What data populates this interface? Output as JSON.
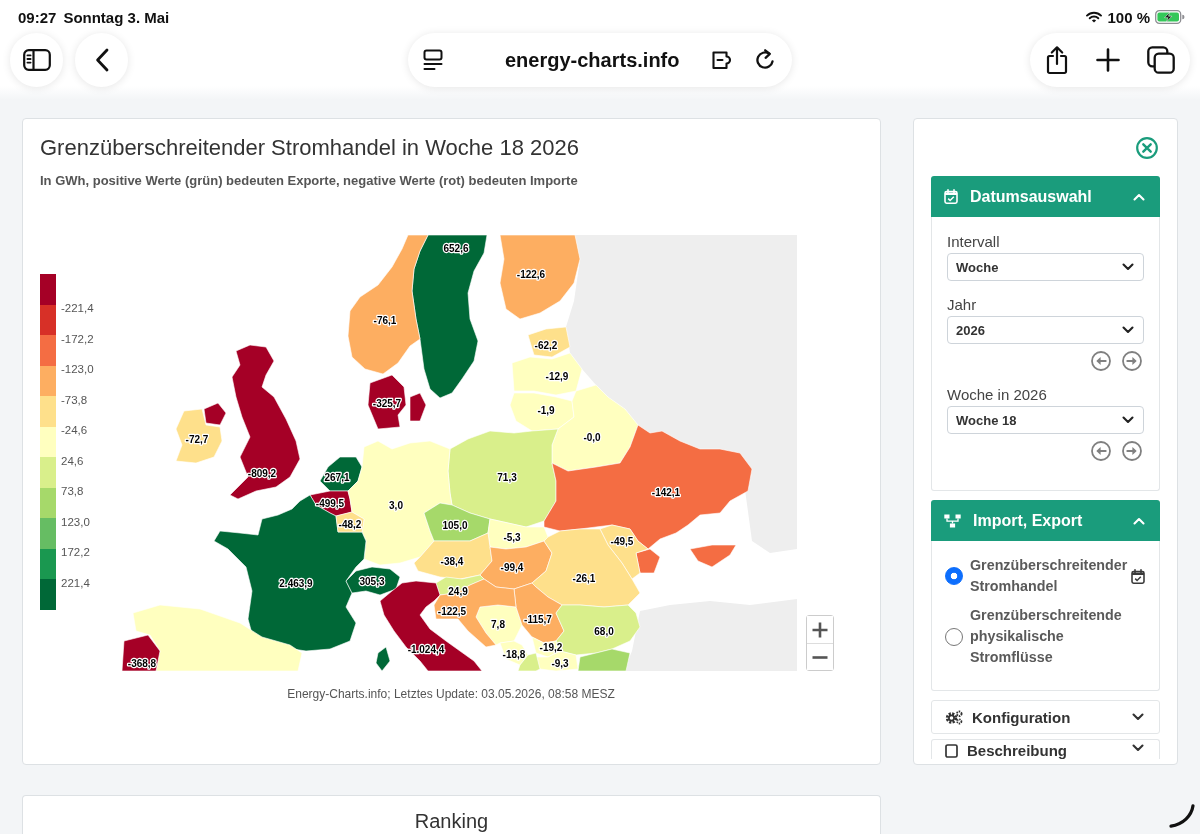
{
  "status_bar": {
    "time": "09:27",
    "date": "Sonntag 3. Mai",
    "battery": "100 %"
  },
  "browser": {
    "url": "energy-charts.info"
  },
  "chart": {
    "title": "Grenzüberschreitender Stromhandel in Woche 18 2026",
    "subtitle": "In GWh, positive Werte (grün) bedeuten Exporte, negative Werte (rot) bedeuten Importe",
    "map": {
      "legend": {
        "bins": [
          {
            "color": "#a50026"
          },
          {
            "color": "#d73027"
          },
          {
            "color": "#f46d43"
          },
          {
            "color": "#fdae61"
          },
          {
            "color": "#fee08b"
          },
          {
            "color": "#ffffbf"
          },
          {
            "color": "#d9ef8b"
          },
          {
            "color": "#a6d96a"
          },
          {
            "color": "#66bd63"
          },
          {
            "color": "#1a9850"
          },
          {
            "color": "#006837"
          }
        ],
        "ticks": [
          "-221,4",
          "-172,2",
          "-123,0",
          "-73,8",
          "-24,6",
          "24,6",
          "73,8",
          "123,0",
          "172,2",
          "221,4"
        ]
      },
      "regions": [
        {
          "value": "652,6",
          "color": "#006837"
        },
        {
          "value": "-122,6",
          "color": "#fdae61"
        },
        {
          "value": "-76,1",
          "color": "#fdae61"
        },
        {
          "value": "-62,2",
          "color": "#fee08b"
        },
        {
          "value": "-12,9",
          "color": "#ffffbf"
        },
        {
          "value": "-325,7",
          "color": "#a50026"
        },
        {
          "value": "-1,9",
          "color": "#ffffbf"
        },
        {
          "value": "-72,7",
          "color": "#fee08b"
        },
        {
          "value": "-0,0",
          "color": "#ffffbf"
        },
        {
          "value": "-809,2",
          "color": "#a50026"
        },
        {
          "value": "267,1",
          "color": "#006837"
        },
        {
          "value": "71,3",
          "color": "#d9ef8b"
        },
        {
          "value": "-142,1",
          "color": "#f46d43"
        },
        {
          "value": "-499,5",
          "color": "#a50026"
        },
        {
          "value": "3,0",
          "color": "#ffffbf"
        },
        {
          "value": "-48,2",
          "color": "#fee08b"
        },
        {
          "value": "105,0",
          "color": "#a6d96a"
        },
        {
          "value": "-5,3",
          "color": "#ffffbf"
        },
        {
          "value": "-49,5",
          "color": "#fee08b"
        },
        {
          "value": "-38,4",
          "color": "#fee08b"
        },
        {
          "value": "-99,4",
          "color": "#fdae61"
        },
        {
          "value": "-26,1",
          "color": "#fee08b"
        },
        {
          "value": "2.463,9",
          "color": "#006837"
        },
        {
          "value": "305,3",
          "color": "#006837"
        },
        {
          "value": "24,9",
          "color": "#d9ef8b"
        },
        {
          "value": "-122,5",
          "color": "#fdae61"
        },
        {
          "value": "7,8",
          "color": "#ffffbf"
        },
        {
          "value": "-115,7",
          "color": "#fdae61"
        },
        {
          "value": "68,0",
          "color": "#d9ef8b"
        },
        {
          "value": "-1.024,4",
          "color": "#a50026"
        },
        {
          "value": "-18,8",
          "color": "#ffffbf"
        },
        {
          "value": "-19,2",
          "color": "#ffffbf"
        },
        {
          "value": "-368,8",
          "color": "#a50026"
        },
        {
          "value": "-9,3",
          "color": "#ffffbf"
        },
        {
          "color": "#ffffbf"
        },
        {
          "color": "#d9ef8b"
        },
        {
          "color": "#a6d96a"
        }
      ]
    },
    "footer": "Energy-Charts.info; Letztes Update: 03.05.2026, 08:58 MESZ"
  },
  "sidebar": {
    "sections": [
      {
        "kind": "date_picker",
        "title": "Datumsauswahl",
        "expanded": true,
        "fields": [
          {
            "label": "Intervall",
            "value": "Woche",
            "stepper": false
          },
          {
            "label": "Jahr",
            "value": "2026",
            "stepper": true
          },
          {
            "label": "Woche in 2026",
            "value": "Woche 18",
            "stepper": true
          }
        ]
      },
      {
        "kind": "radio_list",
        "title": "Import, Export",
        "expanded": true,
        "options": [
          {
            "label": "Grenzüberschreitender Stromhandel",
            "selected": true,
            "calendar": true
          },
          {
            "label": "Grenzüberschreitende physikalische Stromflüsse",
            "selected": false,
            "calendar": false
          }
        ]
      },
      {
        "kind": "settings",
        "title": "Konfiguration",
        "expanded": false
      },
      {
        "kind": "description",
        "title": "Beschreibung",
        "expanded": false
      }
    ]
  },
  "ranking": {
    "title": "Ranking"
  }
}
